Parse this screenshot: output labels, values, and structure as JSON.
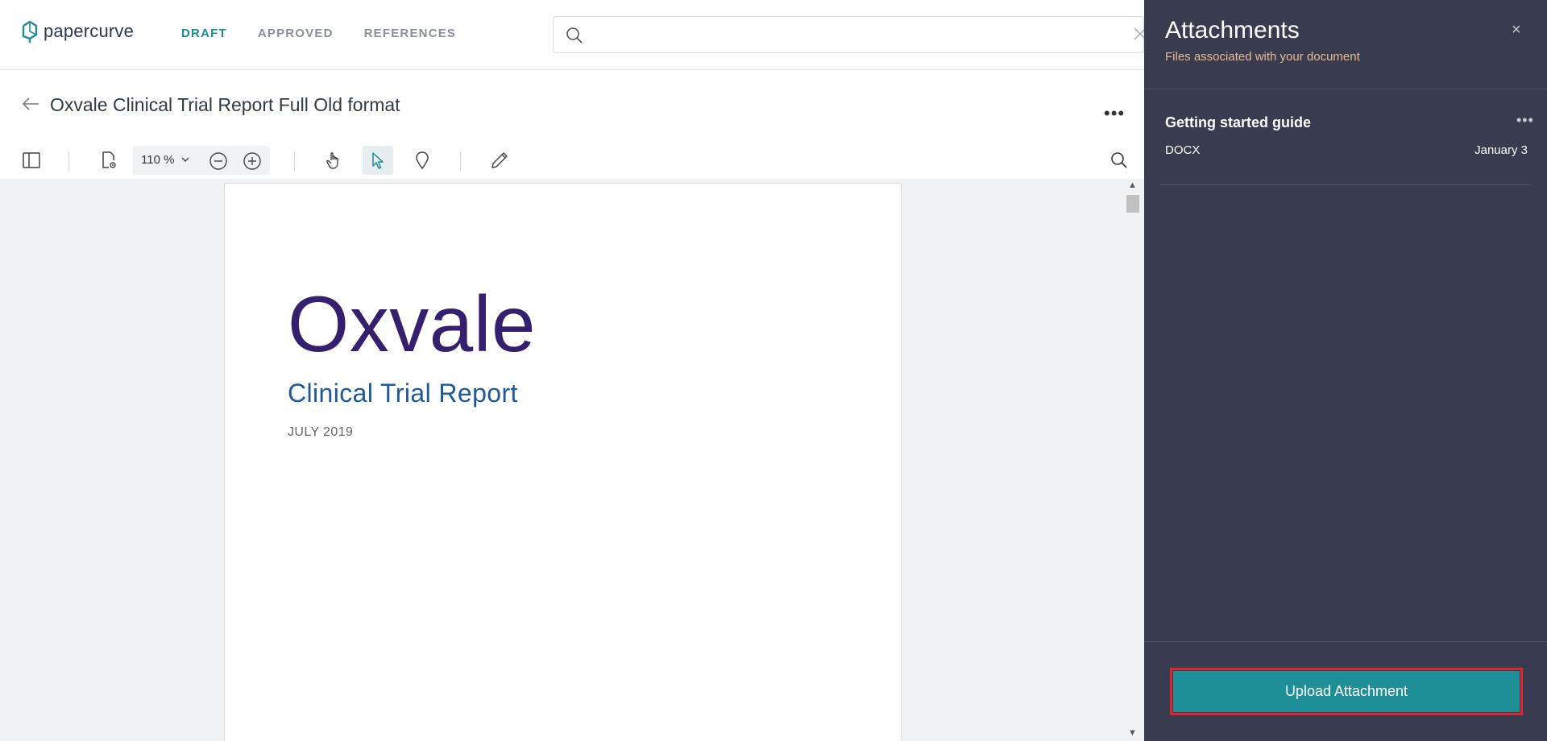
{
  "app": {
    "logo_text": "papercurve"
  },
  "nav": {
    "items": [
      {
        "label": "DRAFT",
        "active": true
      },
      {
        "label": "APPROVED",
        "active": false
      },
      {
        "label": "REFERENCES",
        "active": false
      }
    ]
  },
  "search": {
    "value": "",
    "placeholder": ""
  },
  "document": {
    "title": "Oxvale Clinical Trial Report Full Old format",
    "more_label": "•••"
  },
  "toolbar": {
    "zoom_value": "110 %",
    "selected_tool": "select"
  },
  "page": {
    "brand": "Oxvale",
    "subtitle": "Clinical Trial Report",
    "date": "JULY 2019"
  },
  "attachments": {
    "title": "Attachments",
    "subtitle": "Files associated with your document",
    "close_label": "×",
    "items": [
      {
        "name": "Getting started guide",
        "type": "DOCX",
        "date": "January 3",
        "more_label": "•••"
      }
    ],
    "upload_label": "Upload Attachment"
  },
  "colors": {
    "accent": "#1d8c97",
    "panel_bg": "#383c4e",
    "highlight": "#e02531",
    "brand_purple": "#35206f",
    "subtitle_blue": "#1d5a9c"
  }
}
